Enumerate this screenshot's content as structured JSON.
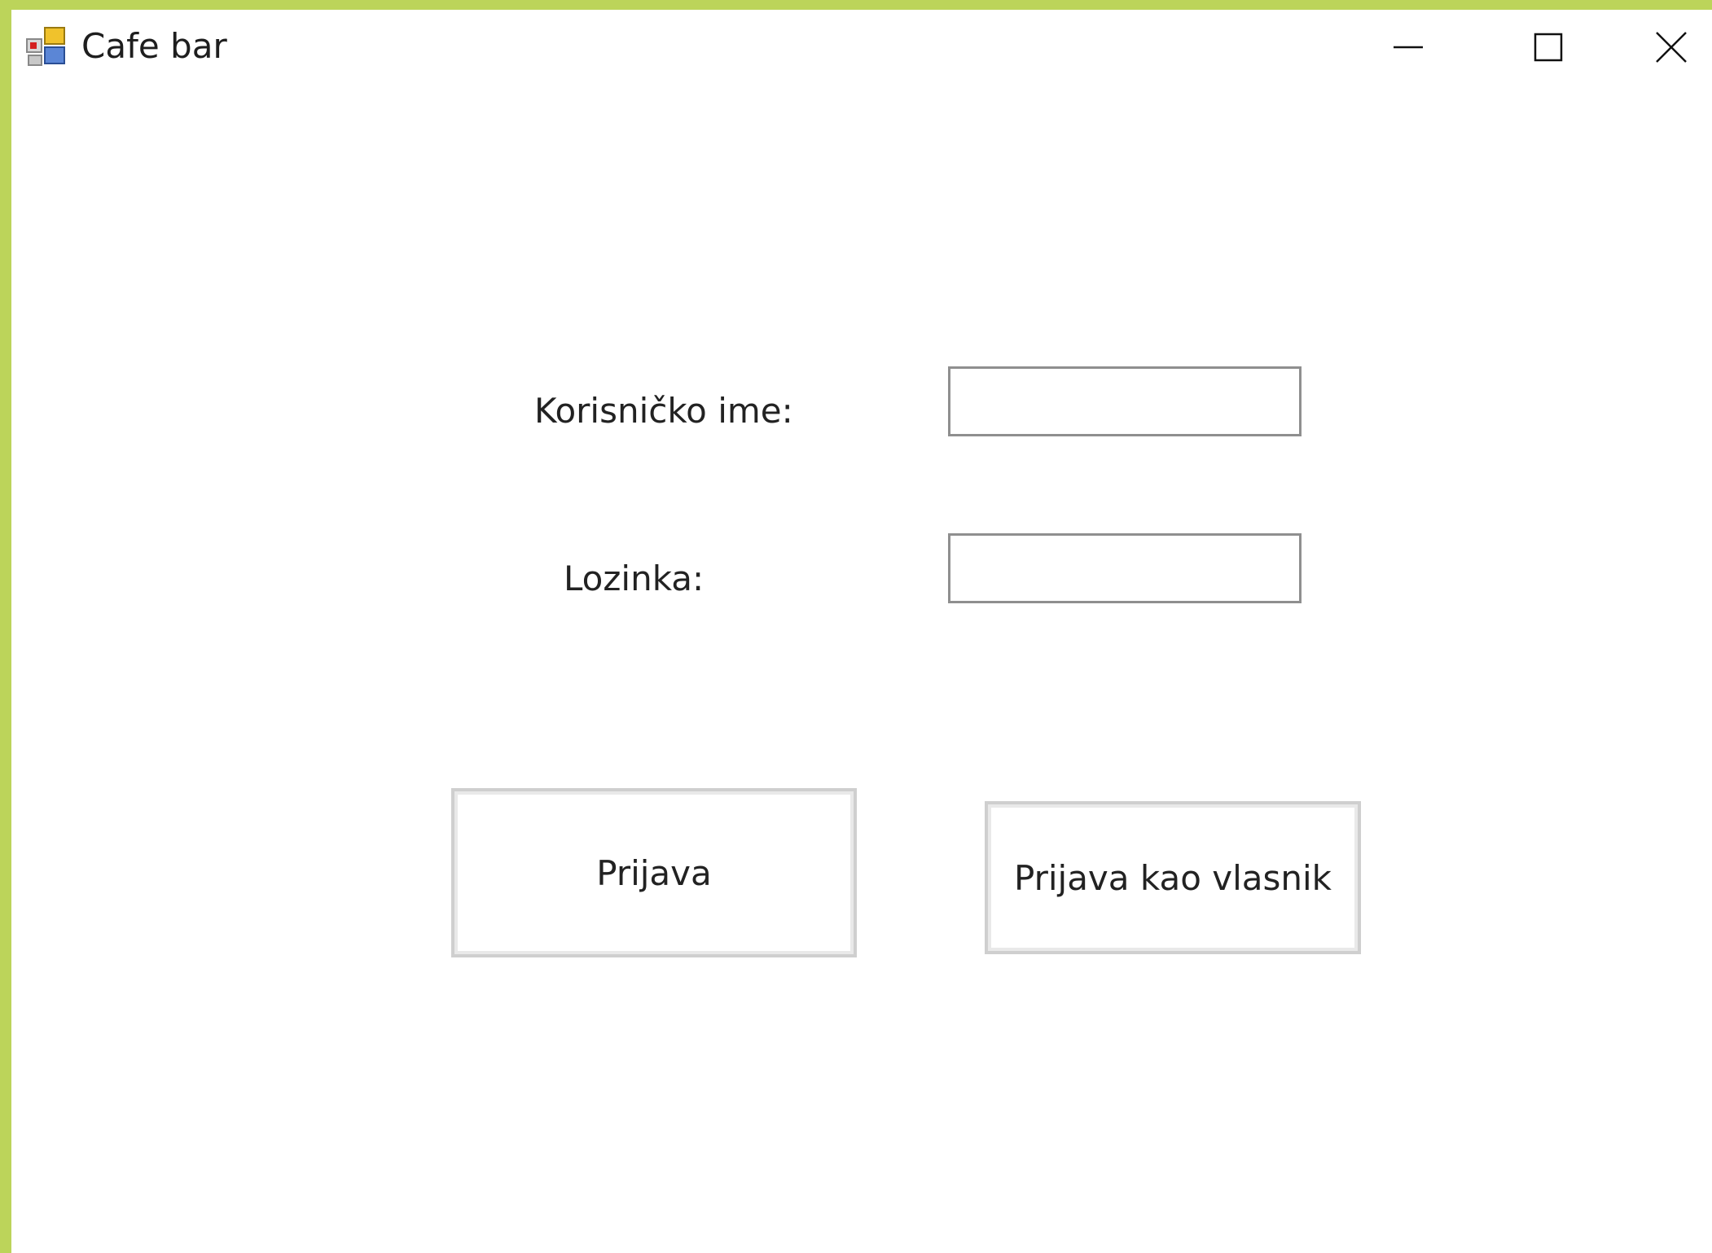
{
  "window": {
    "title": "Cafe bar",
    "icon": "winforms-app-icon",
    "controls": {
      "minimize_icon": "minimize-icon",
      "maximize_icon": "maximize-icon",
      "close_icon": "close-icon"
    },
    "border_color": "#bcd45a"
  },
  "form": {
    "username_label": "Korisničko ime:",
    "username_value": "",
    "password_label": "Lozinka:",
    "password_value": "",
    "login_button": "Prijava",
    "owner_login_button": "Prijava kao vlasnik"
  }
}
